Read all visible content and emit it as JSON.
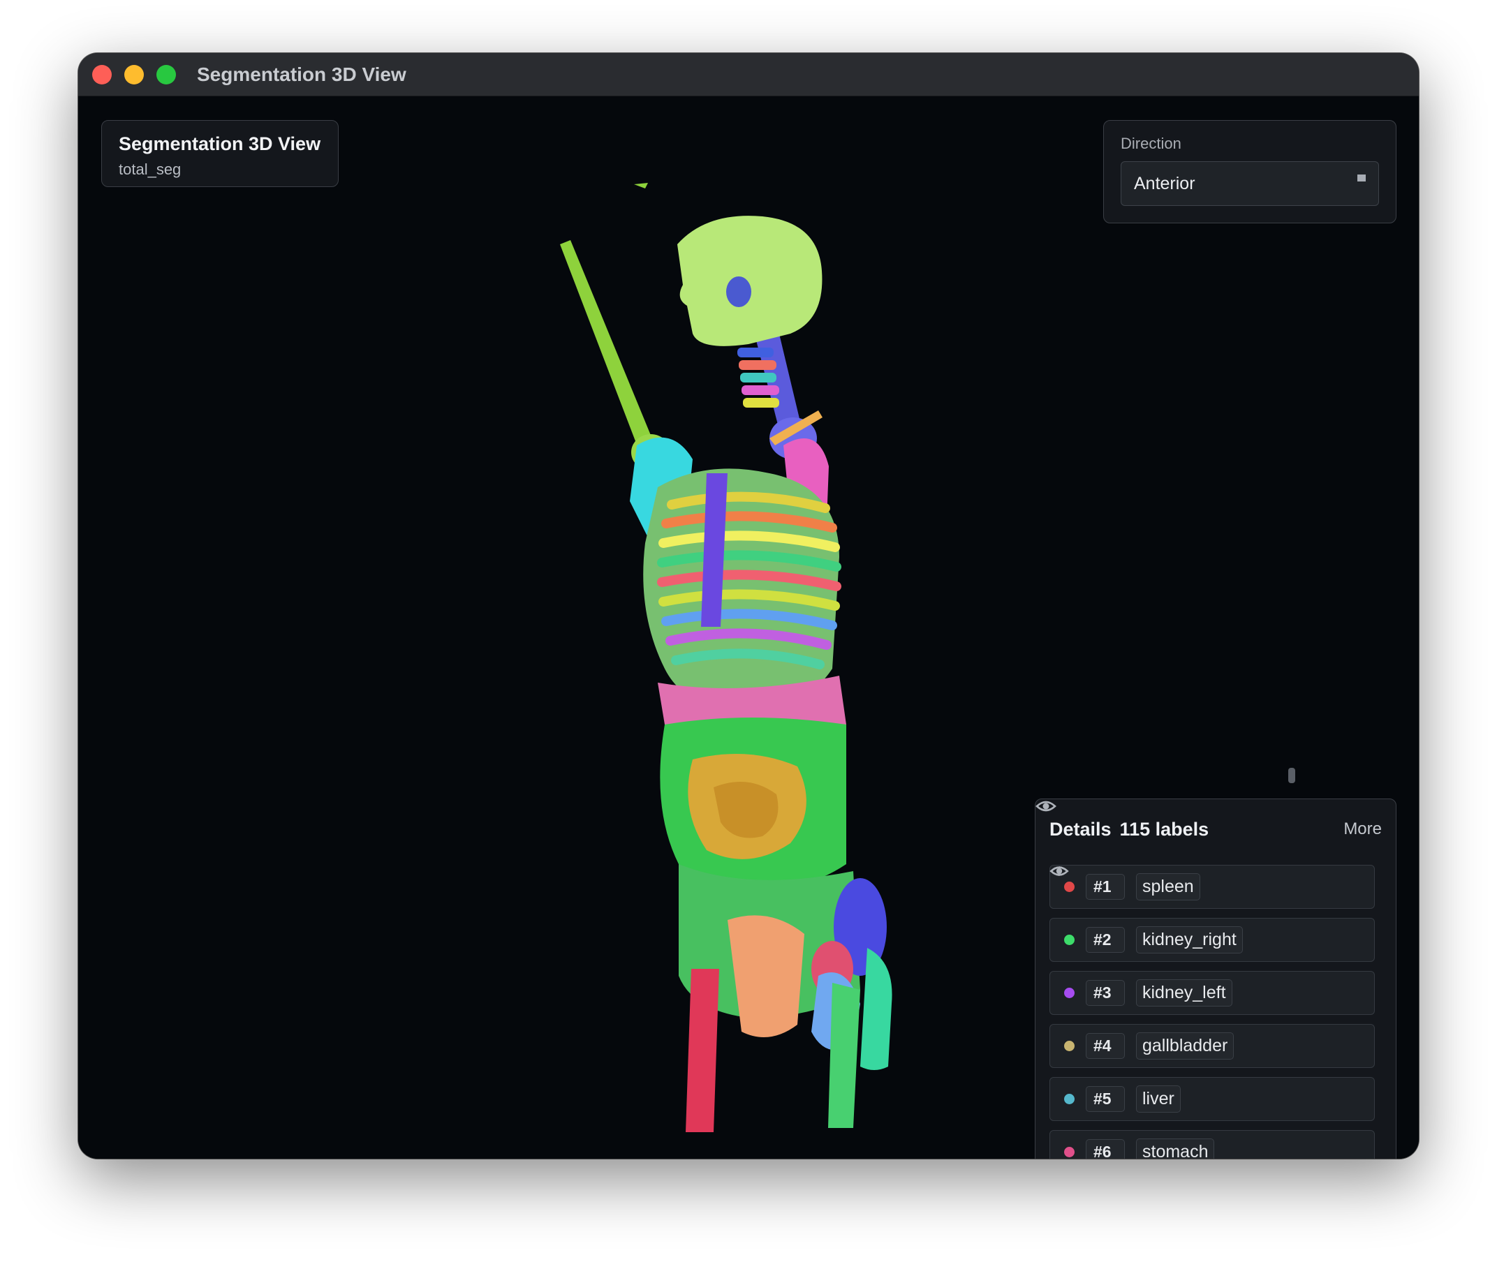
{
  "window": {
    "title": "Segmentation 3D View"
  },
  "overlay": {
    "title": "Segmentation 3D View",
    "subtitle": "total_seg"
  },
  "direction": {
    "label": "Direction",
    "value": "Anterior"
  },
  "details": {
    "title": "Details",
    "count": "115 labels",
    "more_label": "More",
    "items": [
      {
        "index": "#1",
        "name": "spleen",
        "color": "#e04848"
      },
      {
        "index": "#2",
        "name": "kidney_right",
        "color": "#3ddc6a"
      },
      {
        "index": "#3",
        "name": "kidney_left",
        "color": "#a64cf0"
      },
      {
        "index": "#4",
        "name": "gallbladder",
        "color": "#c8b470"
      },
      {
        "index": "#5",
        "name": "liver",
        "color": "#55b8cc"
      },
      {
        "index": "#6",
        "name": "stomach",
        "color": "#e0508a"
      }
    ]
  },
  "icons": {
    "view_toggle": "eye-icon",
    "row_visibility": "eye-icon"
  }
}
